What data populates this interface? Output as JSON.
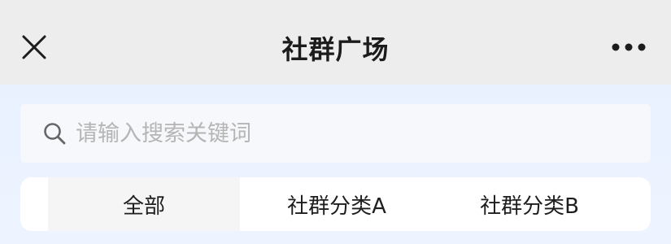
{
  "nav": {
    "title": "社群广场",
    "close_icon": "close-icon",
    "more_icon": "more-horizontal-icon"
  },
  "search": {
    "placeholder": "请输入搜索关键词",
    "value": "",
    "icon": "search-icon"
  },
  "tabs": [
    {
      "label": "全部",
      "active": true
    },
    {
      "label": "社群分类A",
      "active": false
    },
    {
      "label": "社群分类B",
      "active": false
    }
  ],
  "colors": {
    "nav_bg": "#ededed",
    "content_bg": "#eef4ff",
    "active_tab_bg": "#f5f5f5",
    "placeholder": "#b5b5b5"
  }
}
